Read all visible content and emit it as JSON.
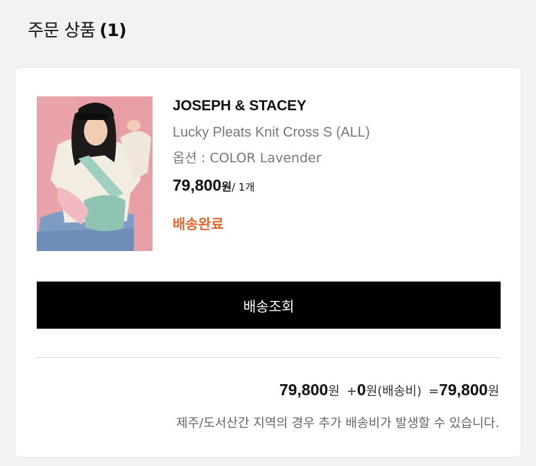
{
  "section": {
    "title": "주문 상품",
    "count": "(1)"
  },
  "product": {
    "image_alt": "product-photo",
    "brand": "JOSEPH & STACEY",
    "name": "Lucky Pleats Knit Cross S (ALL)",
    "option": "옵션 : COLOR Lavender",
    "price": "79,800",
    "price_unit": "원",
    "quantity": "/ 1개",
    "status": "배송완료"
  },
  "actions": {
    "track_label": "배송조회"
  },
  "summary": {
    "product_total": "79,800",
    "won": "원",
    "plus": "+",
    "shipping_fee": "0",
    "shipping_label": "원(배송비)",
    "equals": "=",
    "grand_total": "79,800",
    "notice": "제주/도서산간 지역의 경우 추가 배송비가 발생할 수 있습니다."
  },
  "colors": {
    "status": "#e0662b",
    "button_bg": "#000000",
    "page_bg": "#f2f2f2"
  }
}
